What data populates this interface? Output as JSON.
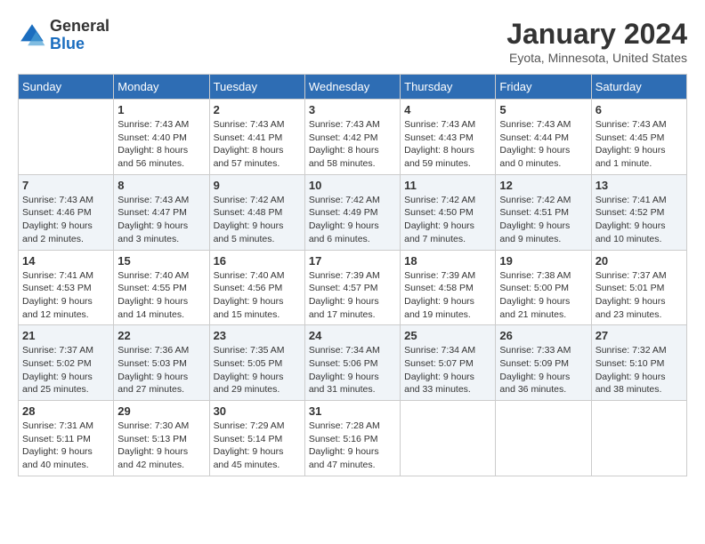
{
  "header": {
    "logo_general": "General",
    "logo_blue": "Blue",
    "month_title": "January 2024",
    "location": "Eyota, Minnesota, United States"
  },
  "days_of_week": [
    "Sunday",
    "Monday",
    "Tuesday",
    "Wednesday",
    "Thursday",
    "Friday",
    "Saturday"
  ],
  "weeks": [
    [
      {
        "day": "",
        "info": ""
      },
      {
        "day": "1",
        "info": "Sunrise: 7:43 AM\nSunset: 4:40 PM\nDaylight: 8 hours\nand 56 minutes."
      },
      {
        "day": "2",
        "info": "Sunrise: 7:43 AM\nSunset: 4:41 PM\nDaylight: 8 hours\nand 57 minutes."
      },
      {
        "day": "3",
        "info": "Sunrise: 7:43 AM\nSunset: 4:42 PM\nDaylight: 8 hours\nand 58 minutes."
      },
      {
        "day": "4",
        "info": "Sunrise: 7:43 AM\nSunset: 4:43 PM\nDaylight: 8 hours\nand 59 minutes."
      },
      {
        "day": "5",
        "info": "Sunrise: 7:43 AM\nSunset: 4:44 PM\nDaylight: 9 hours\nand 0 minutes."
      },
      {
        "day": "6",
        "info": "Sunrise: 7:43 AM\nSunset: 4:45 PM\nDaylight: 9 hours\nand 1 minute."
      }
    ],
    [
      {
        "day": "7",
        "info": "Sunrise: 7:43 AM\nSunset: 4:46 PM\nDaylight: 9 hours\nand 2 minutes."
      },
      {
        "day": "8",
        "info": "Sunrise: 7:43 AM\nSunset: 4:47 PM\nDaylight: 9 hours\nand 3 minutes."
      },
      {
        "day": "9",
        "info": "Sunrise: 7:42 AM\nSunset: 4:48 PM\nDaylight: 9 hours\nand 5 minutes."
      },
      {
        "day": "10",
        "info": "Sunrise: 7:42 AM\nSunset: 4:49 PM\nDaylight: 9 hours\nand 6 minutes."
      },
      {
        "day": "11",
        "info": "Sunrise: 7:42 AM\nSunset: 4:50 PM\nDaylight: 9 hours\nand 7 minutes."
      },
      {
        "day": "12",
        "info": "Sunrise: 7:42 AM\nSunset: 4:51 PM\nDaylight: 9 hours\nand 9 minutes."
      },
      {
        "day": "13",
        "info": "Sunrise: 7:41 AM\nSunset: 4:52 PM\nDaylight: 9 hours\nand 10 minutes."
      }
    ],
    [
      {
        "day": "14",
        "info": "Sunrise: 7:41 AM\nSunset: 4:53 PM\nDaylight: 9 hours\nand 12 minutes."
      },
      {
        "day": "15",
        "info": "Sunrise: 7:40 AM\nSunset: 4:55 PM\nDaylight: 9 hours\nand 14 minutes."
      },
      {
        "day": "16",
        "info": "Sunrise: 7:40 AM\nSunset: 4:56 PM\nDaylight: 9 hours\nand 15 minutes."
      },
      {
        "day": "17",
        "info": "Sunrise: 7:39 AM\nSunset: 4:57 PM\nDaylight: 9 hours\nand 17 minutes."
      },
      {
        "day": "18",
        "info": "Sunrise: 7:39 AM\nSunset: 4:58 PM\nDaylight: 9 hours\nand 19 minutes."
      },
      {
        "day": "19",
        "info": "Sunrise: 7:38 AM\nSunset: 5:00 PM\nDaylight: 9 hours\nand 21 minutes."
      },
      {
        "day": "20",
        "info": "Sunrise: 7:37 AM\nSunset: 5:01 PM\nDaylight: 9 hours\nand 23 minutes."
      }
    ],
    [
      {
        "day": "21",
        "info": "Sunrise: 7:37 AM\nSunset: 5:02 PM\nDaylight: 9 hours\nand 25 minutes."
      },
      {
        "day": "22",
        "info": "Sunrise: 7:36 AM\nSunset: 5:03 PM\nDaylight: 9 hours\nand 27 minutes."
      },
      {
        "day": "23",
        "info": "Sunrise: 7:35 AM\nSunset: 5:05 PM\nDaylight: 9 hours\nand 29 minutes."
      },
      {
        "day": "24",
        "info": "Sunrise: 7:34 AM\nSunset: 5:06 PM\nDaylight: 9 hours\nand 31 minutes."
      },
      {
        "day": "25",
        "info": "Sunrise: 7:34 AM\nSunset: 5:07 PM\nDaylight: 9 hours\nand 33 minutes."
      },
      {
        "day": "26",
        "info": "Sunrise: 7:33 AM\nSunset: 5:09 PM\nDaylight: 9 hours\nand 36 minutes."
      },
      {
        "day": "27",
        "info": "Sunrise: 7:32 AM\nSunset: 5:10 PM\nDaylight: 9 hours\nand 38 minutes."
      }
    ],
    [
      {
        "day": "28",
        "info": "Sunrise: 7:31 AM\nSunset: 5:11 PM\nDaylight: 9 hours\nand 40 minutes."
      },
      {
        "day": "29",
        "info": "Sunrise: 7:30 AM\nSunset: 5:13 PM\nDaylight: 9 hours\nand 42 minutes."
      },
      {
        "day": "30",
        "info": "Sunrise: 7:29 AM\nSunset: 5:14 PM\nDaylight: 9 hours\nand 45 minutes."
      },
      {
        "day": "31",
        "info": "Sunrise: 7:28 AM\nSunset: 5:16 PM\nDaylight: 9 hours\nand 47 minutes."
      },
      {
        "day": "",
        "info": ""
      },
      {
        "day": "",
        "info": ""
      },
      {
        "day": "",
        "info": ""
      }
    ]
  ]
}
